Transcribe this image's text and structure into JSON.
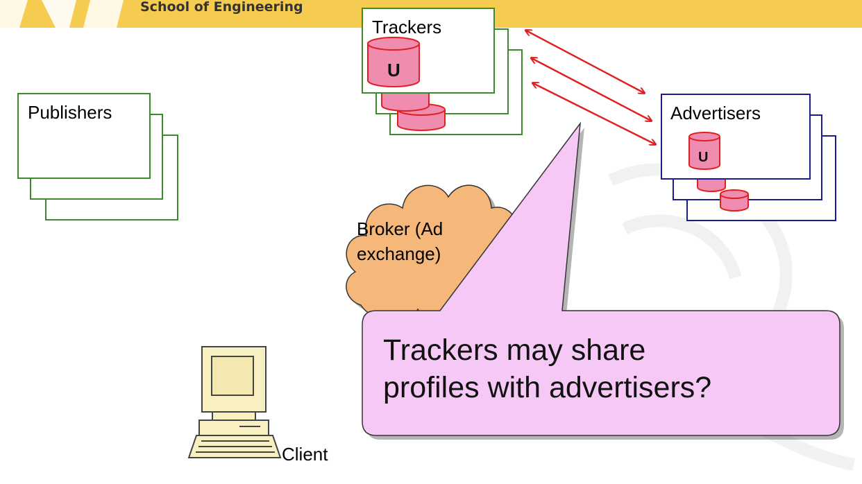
{
  "header": {
    "school_label": "School of Engineering"
  },
  "nodes": {
    "publishers_label": "Publishers",
    "trackers_label": "Trackers",
    "advertisers_label": "Advertisers",
    "broker_line1": "Broker  (Ad",
    "broker_line2": "exchange)",
    "client_label": "Client",
    "db_letter": "U"
  },
  "callout": {
    "line1": "Trackers may share",
    "line2": "profiles with advertisers?"
  },
  "colors": {
    "banner": "#f5cc50",
    "publisher_border": "#3a8a2a",
    "tracker_border": "#3a8a2a",
    "advertiser_border": "#1a1a8a",
    "database_fill": "#f08cb0",
    "database_stroke": "#e02020",
    "arrow": "#e02020",
    "cloud_fill": "#f5b87a",
    "callout_fill": "#f5c8f5"
  }
}
